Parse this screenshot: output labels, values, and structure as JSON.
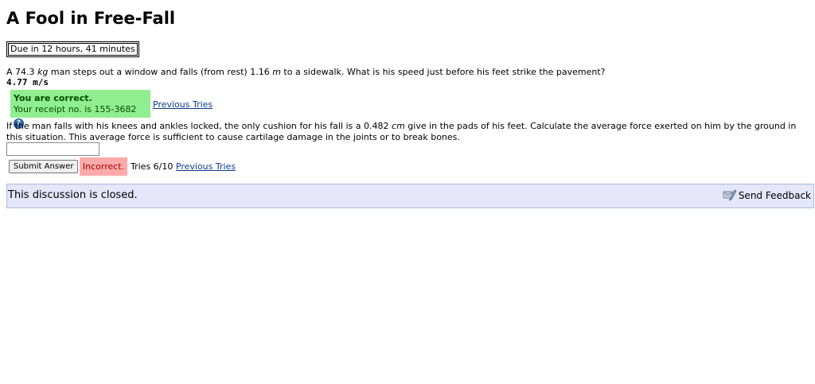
{
  "page": {
    "title": "A Fool in Free-Fall",
    "due": "Due in 12 hours, 41 minutes"
  },
  "part1": {
    "question_a": "A 74.3 ",
    "question_unit1": "kg",
    "question_b": " man steps out a window and falls (from rest) 1.16 ",
    "question_unit2": "m",
    "question_c": " to a sidewalk. What is his speed just before his feet strike the pavement?",
    "answer": "4.77 m/s",
    "correct_title": "You are correct.",
    "receipt": "Your receipt no. is 155-3682",
    "help_icon_glyph": "?",
    "previous_tries": "Previous Tries"
  },
  "part2": {
    "question_a": "If the man falls with his knees and ankles locked, the only cushion for his fall is a 0.482 ",
    "question_unit": "cm",
    "question_b": " give in the pads of his feet. Calculate the average force exerted on him by the ground in this situation. This average force is sufficient to cause cartilage damage in the joints or to break bones.",
    "input_value": "",
    "submit_label": "Submit Answer",
    "status": "Incorrect.",
    "tries": "Tries 6/10",
    "previous_tries": "Previous Tries"
  },
  "discussion": {
    "status": "This discussion is closed.",
    "feedback_label": "Send Feedback",
    "feedback_icon": "feedback-icon"
  },
  "colors": {
    "correct_bg": "#90ee90",
    "incorrect_bg": "#ffaaaa",
    "discussion_bg": "#e5e6fa",
    "link": "#0b3b8c"
  }
}
